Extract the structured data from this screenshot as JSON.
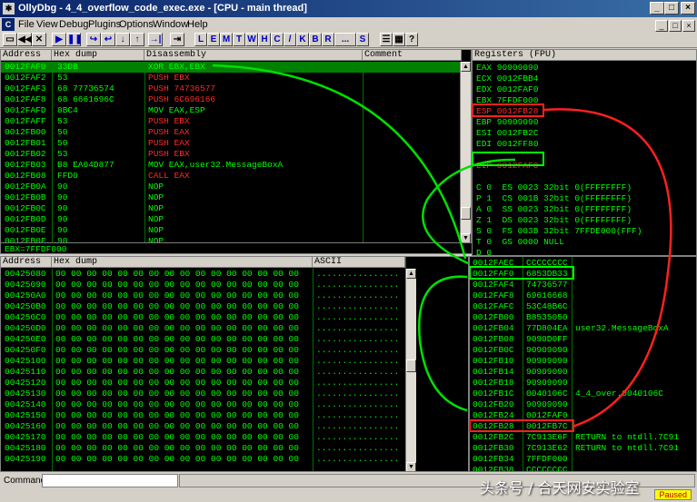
{
  "window": {
    "title": "OllyDbg - 4_4_overflow_code_exec.exe - [CPU - main thread]",
    "btn_min": "_",
    "btn_max": "□",
    "btn_close": "×"
  },
  "menu": {
    "icon": "C",
    "items": [
      "File",
      "View",
      "Debug",
      "Plugins",
      "Options",
      "Window",
      "Help"
    ],
    "mdi_min": "_",
    "mdi_max": "□",
    "mdi_close": "×"
  },
  "toolbar": {
    "buttons": [
      "▭",
      "◀◀",
      "✕",
      "▶",
      "❚❚",
      "↪",
      "↩",
      "↓",
      "↑",
      "→|",
      "⇥"
    ],
    "letters": [
      "L",
      "E",
      "M",
      "T",
      "W",
      "H",
      "C",
      "/",
      "K",
      "B",
      "R",
      "...",
      "S"
    ],
    "extra": [
      "☰",
      "▦",
      "?"
    ]
  },
  "disasm": {
    "headers": {
      "address": "Address",
      "hex": "Hex dump",
      "disasm": "Disassembly",
      "comment": "Comment"
    },
    "rows": [
      {
        "addr": "0012FAF0",
        "hex": "33DB",
        "asm": "XOR EBX,EBX",
        "red": false,
        "sel": true
      },
      {
        "addr": "0012FAF2",
        "hex": "53",
        "asm": "PUSH EBX",
        "red": true,
        "sel": false
      },
      {
        "addr": "0012FAF3",
        "hex": "68 77736574",
        "asm": "PUSH 74736577",
        "red": true,
        "sel": false
      },
      {
        "addr": "0012FAF8",
        "hex": "68 6661696C",
        "asm": "PUSH 6C696166",
        "red": true,
        "sel": false
      },
      {
        "addr": "0012FAFD",
        "hex": "8BC4",
        "asm": "MOV EAX,ESP",
        "red": false,
        "sel": false
      },
      {
        "addr": "0012FAFF",
        "hex": "53",
        "asm": "PUSH EBX",
        "red": true,
        "sel": false
      },
      {
        "addr": "0012FB00",
        "hex": "50",
        "asm": "PUSH EAX",
        "red": true,
        "sel": false
      },
      {
        "addr": "0012FB01",
        "hex": "50",
        "asm": "PUSH EAX",
        "red": true,
        "sel": false
      },
      {
        "addr": "0012FB02",
        "hex": "53",
        "asm": "PUSH EBX",
        "red": true,
        "sel": false
      },
      {
        "addr": "0012FB03",
        "hex": "B8 EA04D877",
        "asm": "MOV EAX,user32.MessageBoxA",
        "red": false,
        "sel": false
      },
      {
        "addr": "0012FB08",
        "hex": "FFD0",
        "asm": "CALL EAX",
        "red": true,
        "sel": false
      },
      {
        "addr": "0012FB0A",
        "hex": "90",
        "asm": "NOP",
        "red": false,
        "sel": false
      },
      {
        "addr": "0012FB0B",
        "hex": "90",
        "asm": "NOP",
        "red": false,
        "sel": false
      },
      {
        "addr": "0012FB0C",
        "hex": "90",
        "asm": "NOP",
        "red": false,
        "sel": false
      },
      {
        "addr": "0012FB0D",
        "hex": "90",
        "asm": "NOP",
        "red": false,
        "sel": false
      },
      {
        "addr": "0012FB0E",
        "hex": "90",
        "asm": "NOP",
        "red": false,
        "sel": false
      },
      {
        "addr": "0012FB0F",
        "hex": "90",
        "asm": "NOP",
        "red": false,
        "sel": false
      }
    ]
  },
  "status_line": "EBX=7FFDF000",
  "registers": {
    "header": "Registers (FPU)",
    "lines": [
      {
        "text": "EAX 90909090",
        "red": false
      },
      {
        "text": "ECX 0012FBB4",
        "red": false
      },
      {
        "text": "EDX 0012FAF0",
        "red": false
      },
      {
        "text": "EBX 7FFDF000",
        "red": false
      },
      {
        "text": "ESP 0012FB28",
        "red": true
      },
      {
        "text": "EBP 90909090",
        "red": false
      },
      {
        "text": "ESI 0012FB2C",
        "red": false
      },
      {
        "text": "EDI 0012FF80",
        "red": false
      },
      {
        "text": "",
        "red": false
      },
      {
        "text": "EIP 0012FAF0",
        "red": true
      },
      {
        "text": "",
        "red": false
      },
      {
        "text": "C 0  ES 0023 32bit 0(FFFFFFFF)",
        "red": false
      },
      {
        "text": "P 1  CS 001B 32bit 0(FFFFFFFF)",
        "red": false
      },
      {
        "text": "A 0  SS 0023 32bit 0(FFFFFFFF)",
        "red": false
      },
      {
        "text": "Z 1  DS 0023 32bit 0(FFFFFFFF)",
        "red": false
      },
      {
        "text": "S 0  FS 003B 32bit 7FFDE000(FFF)",
        "red": false
      },
      {
        "text": "T 0  GS 0000 NULL",
        "red": false
      },
      {
        "text": "D 0",
        "red": false
      },
      {
        "text": "O 0  LastErr ERROR_SUCCESS (00000000)",
        "red": false
      }
    ]
  },
  "dump": {
    "headers": {
      "address": "Address",
      "hex": "Hex dump",
      "ascii": "ASCII"
    },
    "addrs": [
      "00425080",
      "00425090",
      "004250A0",
      "004250B0",
      "004250C0",
      "004250D0",
      "004250E0",
      "004250F0",
      "00425100",
      "00425110",
      "00425120",
      "00425130",
      "00425140",
      "00425150",
      "00425160",
      "00425170",
      "00425180",
      "00425190"
    ],
    "hex_line": "00 00 00 00 00 00 00 00 00 00 00 00 00 00 00 00",
    "ascii_line": "................"
  },
  "stack": {
    "rows": [
      {
        "addr": "0012FAEC",
        "val": "CCCCCCCC",
        "comment": ""
      },
      {
        "addr": "0012FAF0",
        "val": "6853DB33",
        "comment": ""
      },
      {
        "addr": "0012FAF4",
        "val": "74736577",
        "comment": ""
      },
      {
        "addr": "0012FAF8",
        "val": "69616668",
        "comment": ""
      },
      {
        "addr": "0012FAFC",
        "val": "53C48B6C",
        "comment": ""
      },
      {
        "addr": "0012FB00",
        "val": "B8535050",
        "comment": ""
      },
      {
        "addr": "0012FB04",
        "val": "77D804EA",
        "comment": "user32.MessageBoxA"
      },
      {
        "addr": "0012FB08",
        "val": "9090D0FF",
        "comment": ""
      },
      {
        "addr": "0012FB0C",
        "val": "90909090",
        "comment": ""
      },
      {
        "addr": "0012FB10",
        "val": "90909090",
        "comment": ""
      },
      {
        "addr": "0012FB14",
        "val": "90909090",
        "comment": ""
      },
      {
        "addr": "0012FB18",
        "val": "90909090",
        "comment": ""
      },
      {
        "addr": "0012FB1C",
        "val": "0040106C",
        "comment": "4_4_over.0040106C"
      },
      {
        "addr": "0012FB20",
        "val": "90909090",
        "comment": ""
      },
      {
        "addr": "0012FB24",
        "val": "0012FAF0",
        "comment": ""
      },
      {
        "addr": "0012FB28",
        "val": "0012FB7C",
        "comment": ""
      },
      {
        "addr": "0012FB2C",
        "val": "7C913E6F",
        "comment": "RETURN to ntdll.7C91"
      },
      {
        "addr": "0012FB30",
        "val": "7C913E62",
        "comment": "RETURN to ntdll.7C91"
      },
      {
        "addr": "0012FB34",
        "val": "7FFDF000",
        "comment": ""
      },
      {
        "addr": "0012FB38",
        "val": "CCCCCCCC",
        "comment": ""
      }
    ]
  },
  "command": {
    "label": "Command :",
    "value": ""
  },
  "statusbar": {
    "state": "Paused"
  },
  "watermark": "头条号 / 合天网安实验室",
  "colors": {
    "green": "#00ff00",
    "red": "#ff2a2a",
    "bg": "#000000"
  }
}
